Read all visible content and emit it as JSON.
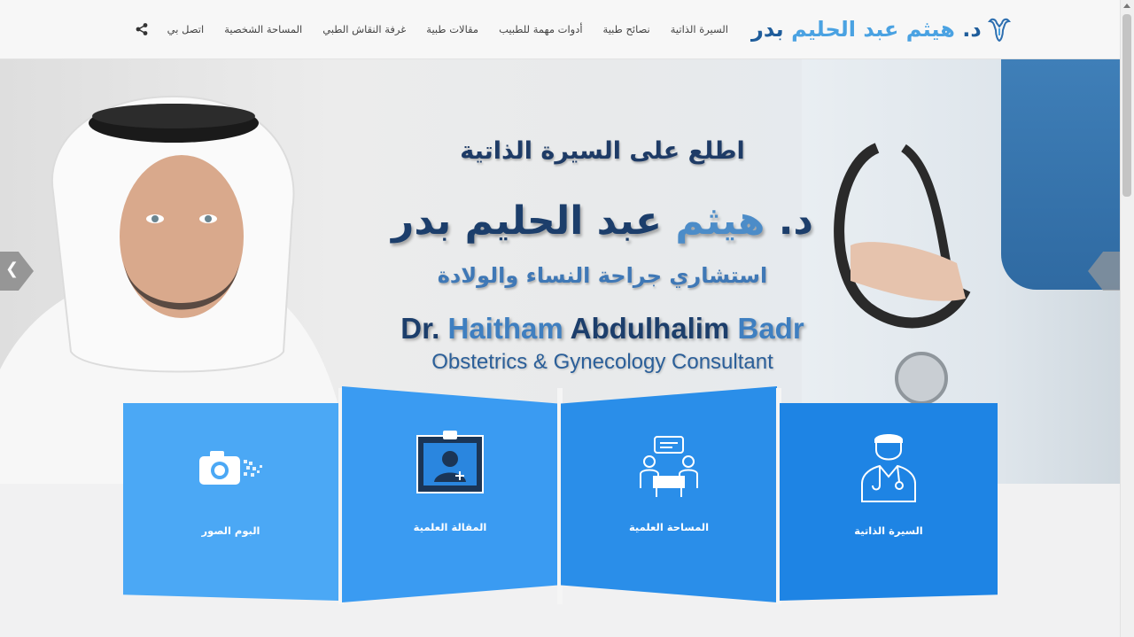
{
  "header": {
    "logo_prefix": "د.",
    "logo_name": "هيثم عبد الحليم",
    "logo_surname": "بدر",
    "nav": [
      "السيرة الذاتية",
      "نصائح طبية",
      "أدوات مهمة للطبيب",
      "مقالات طبية",
      "غرفة النقاش الطبي",
      "المساحة الشخصية",
      "اتصل بي"
    ],
    "share_icon": "share-icon"
  },
  "hero": {
    "intro": "اطلع على السيرة الذاتية",
    "name_prefix": "د.",
    "name_first": "هيثم",
    "name_rest": "عبد الحليم بدر",
    "title_ar": "استشاري جراحة النساء والولادة",
    "en_prefix": "Dr.",
    "en_first": "Haitham",
    "en_middle": "Abdulhalim",
    "en_last": "Badr",
    "en_title": "Obstetrics & Gynecology Consultant"
  },
  "cards": [
    {
      "label": "البوم الصور",
      "icon": "camera-icon"
    },
    {
      "label": "المقالة العلمية",
      "icon": "id-badge-icon"
    },
    {
      "label": "المساحة العلمية",
      "icon": "discussion-icon"
    },
    {
      "label": "السيرة الذاتية",
      "icon": "doctor-icon"
    }
  ],
  "colors": {
    "brand_dark": "#1f5d9b",
    "brand_light": "#4aa2e2",
    "card_1": "#4ba8f5",
    "card_2": "#3a9bf2",
    "card_3": "#2a8ee9",
    "card_4": "#1e84e4"
  }
}
